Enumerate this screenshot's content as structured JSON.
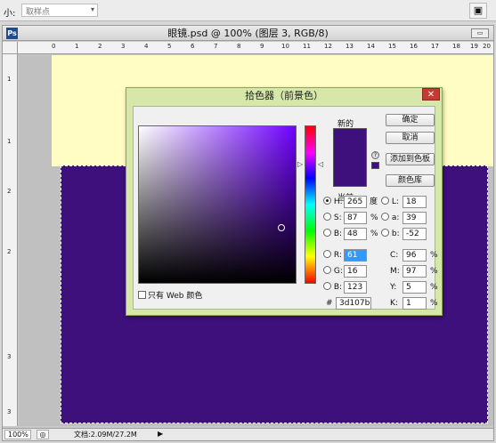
{
  "options_bar": {
    "size_label": "小:",
    "sample_select": "取样点",
    "workspace_icon": "workspace-icon"
  },
  "document": {
    "title": "眼镜.psd @ 100% (图层 3, RGB/8)",
    "icon_glyph": "Ps",
    "hruler_ticks": [
      "0",
      "1",
      "2",
      "3",
      "4",
      "5",
      "6",
      "7",
      "8",
      "9",
      "10",
      "11",
      "12",
      "13",
      "14",
      "15",
      "16",
      "17",
      "18",
      "19",
      "20"
    ],
    "vruler_ticks": [
      "1",
      "1",
      "2",
      "2",
      "3",
      "3"
    ],
    "status": {
      "zoom": "100%",
      "doc_info": "文档:2.09M/27.2M",
      "play_glyph": "▶"
    },
    "canvas_color": "#3d107b",
    "top_band_color": "#fffdc4"
  },
  "color_picker": {
    "title": "拾色器（前景色）",
    "close_glyph": "✕",
    "new_label": "新的",
    "current_label": "当前",
    "web_only_label": "只有 Web 颜色",
    "buttons": {
      "ok": "确定",
      "cancel": "取消",
      "add_to_swatches": "添加到色板",
      "color_libraries": "颜色库"
    },
    "hsb": {
      "h_label": "H:",
      "h": "265",
      "h_unit": "度",
      "s_label": "S:",
      "s": "87",
      "s_unit": "%",
      "b_label": "B:",
      "b": "48",
      "b_unit": "%"
    },
    "lab": {
      "l_label": "L:",
      "l": "18",
      "a_label": "a:",
      "a": "39",
      "b_label": "b:",
      "b": "-52"
    },
    "rgb": {
      "r_label": "R:",
      "r": "61",
      "g_label": "G:",
      "g": "16",
      "b_label": "B:",
      "b": "123"
    },
    "cmyk": {
      "c_label": "C:",
      "c": "96",
      "m_label": "M:",
      "m": "97",
      "y_label": "Y:",
      "y": "5",
      "k_label": "K:",
      "k": "1",
      "unit": "%"
    },
    "hex_label": "#",
    "hex": "3d107b",
    "selected_color": "#3d107b",
    "hue_slider_position": 0.26
  }
}
